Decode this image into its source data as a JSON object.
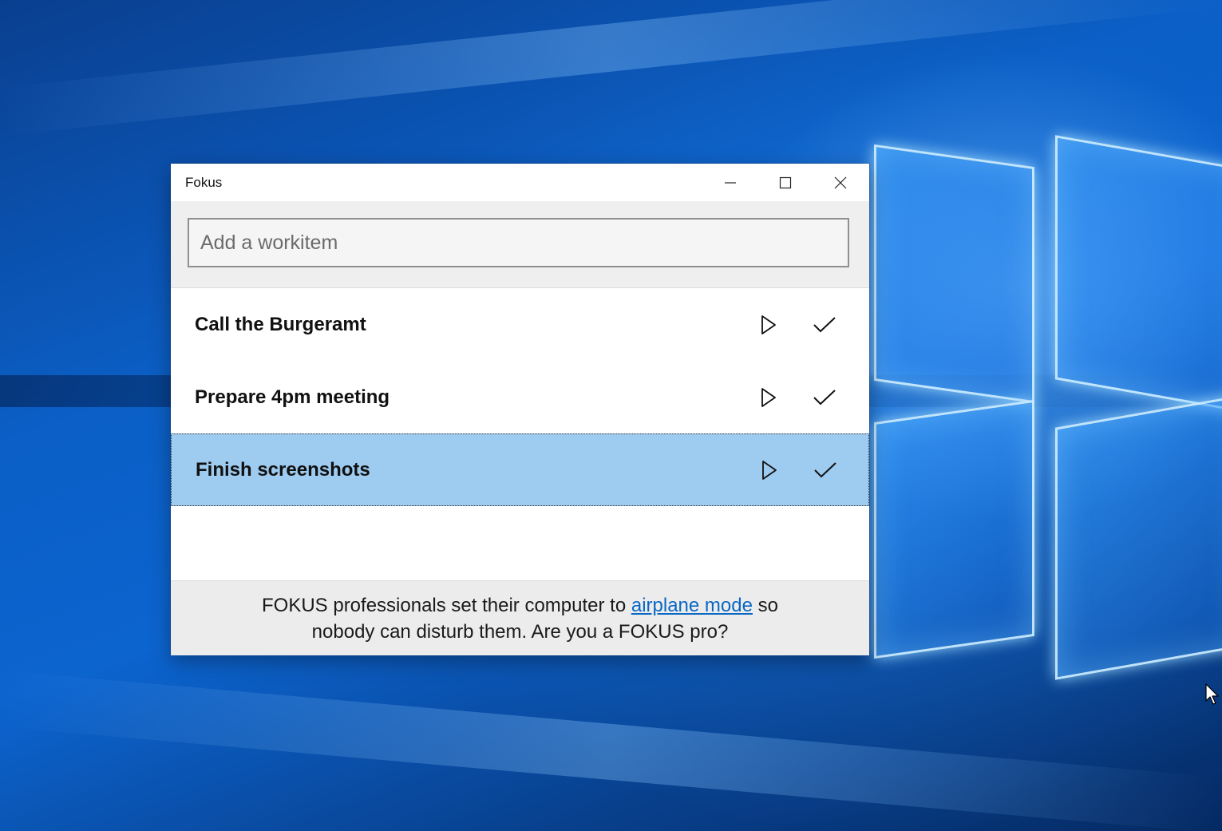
{
  "window": {
    "title": "Fokus",
    "minimize_label": "Minimize",
    "maximize_label": "Maximize",
    "close_label": "Close"
  },
  "input": {
    "placeholder": "Add a workitem",
    "value": ""
  },
  "items": [
    {
      "label": "Call the Burgeramt",
      "selected": false
    },
    {
      "label": "Prepare 4pm meeting",
      "selected": false
    },
    {
      "label": "Finish screenshots",
      "selected": true
    }
  ],
  "footer": {
    "text_before": "FOKUS professionals set their computer to ",
    "link_text": "airplane mode",
    "text_mid": " so",
    "text_after": "nobody can disturb them. Are you a FOKUS pro?"
  },
  "colors": {
    "selected_row": "#9ecbf0",
    "link": "#0a68c5",
    "desktop_blue": "#0b5fc6"
  },
  "icons": {
    "minimize": "minimize-icon",
    "maximize": "maximize-icon",
    "close": "close-icon",
    "play": "play-icon",
    "check": "check-icon"
  }
}
